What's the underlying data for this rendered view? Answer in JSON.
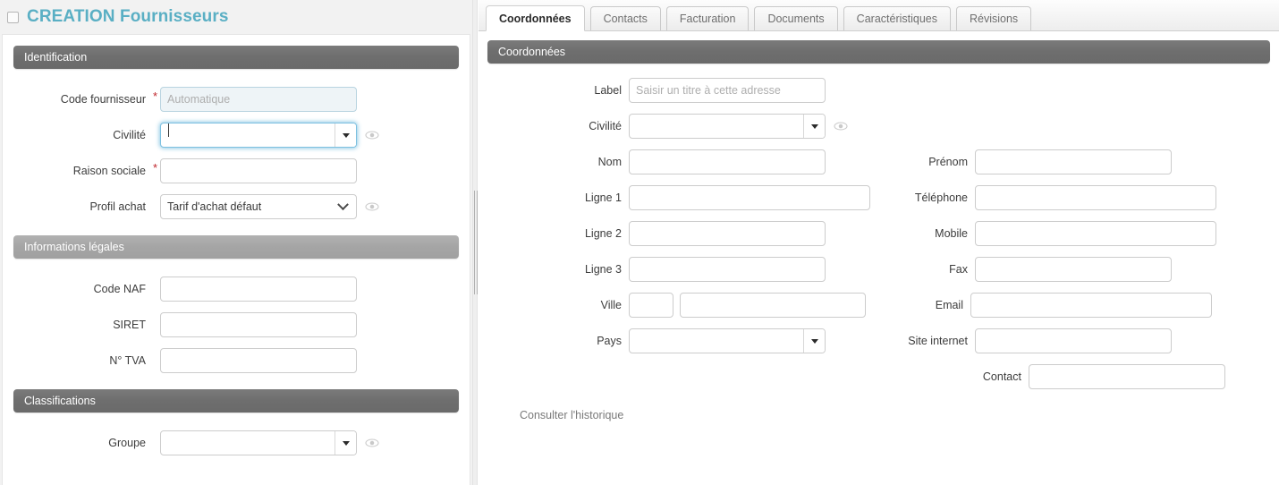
{
  "page": {
    "title": "CREATION Fournisseurs",
    "title_color": "#5aafc4",
    "checkbox_checked": false
  },
  "tabs": [
    {
      "label": "Coordonnées",
      "active": true
    },
    {
      "label": "Contacts",
      "active": false
    },
    {
      "label": "Facturation",
      "active": false
    },
    {
      "label": "Documents",
      "active": false
    },
    {
      "label": "Caractéristiques",
      "active": false
    },
    {
      "label": "Révisions",
      "active": false
    }
  ],
  "left": {
    "sections": [
      {
        "key": "identification",
        "title": "Identification",
        "style": "dark"
      },
      {
        "key": "informations_legales",
        "title": "Informations légales",
        "style": "light"
      },
      {
        "key": "classifications",
        "title": "Classifications",
        "style": "dark"
      }
    ],
    "identification": {
      "code_fournisseur": {
        "label": "Code fournisseur",
        "required": true,
        "placeholder": "Automatique",
        "value": "",
        "readonly": true
      },
      "civilite": {
        "label": "Civilité",
        "required": false,
        "value": "",
        "focused": true,
        "has_eye": true
      },
      "raison_sociale": {
        "label": "Raison sociale",
        "required": true,
        "value": ""
      },
      "profil_achat": {
        "label": "Profil achat",
        "required": false,
        "value": "Tarif d'achat défaut",
        "has_eye": true
      }
    },
    "informations_legales": {
      "code_naf": {
        "label": "Code NAF",
        "value": ""
      },
      "siret": {
        "label": "SIRET",
        "value": ""
      },
      "n_tva": {
        "label": "N° TVA",
        "value": ""
      }
    },
    "classifications": {
      "groupe": {
        "label": "Groupe",
        "value": "",
        "has_eye": true
      }
    }
  },
  "right": {
    "section_title": "Coordonnées",
    "middle_column": {
      "label_field": {
        "label": "Label",
        "placeholder": "Saisir un titre à cette adresse",
        "value": ""
      },
      "civilite": {
        "label": "Civilité",
        "value": "",
        "has_eye": true
      },
      "nom": {
        "label": "Nom",
        "value": ""
      },
      "ligne1": {
        "label": "Ligne 1",
        "value": ""
      },
      "ligne2": {
        "label": "Ligne 2",
        "value": ""
      },
      "ligne3": {
        "label": "Ligne 3",
        "value": ""
      },
      "ville": {
        "label": "Ville",
        "code_value": "",
        "name_value": ""
      },
      "pays": {
        "label": "Pays",
        "value": ""
      }
    },
    "right_column": {
      "prenom": {
        "label": "Prénom",
        "value": ""
      },
      "telephone": {
        "label": "Téléphone",
        "value": ""
      },
      "mobile": {
        "label": "Mobile",
        "value": ""
      },
      "fax": {
        "label": "Fax",
        "value": ""
      },
      "email": {
        "label": "Email",
        "value": ""
      },
      "site_internet": {
        "label": "Site internet",
        "value": ""
      },
      "contact": {
        "label": "Contact",
        "value": ""
      }
    },
    "history_link": "Consulter l'historique"
  },
  "icons": {
    "eye": "eye-icon",
    "dropdown_arrow": "chevron-down-icon",
    "splitter": "splitter-grip"
  }
}
